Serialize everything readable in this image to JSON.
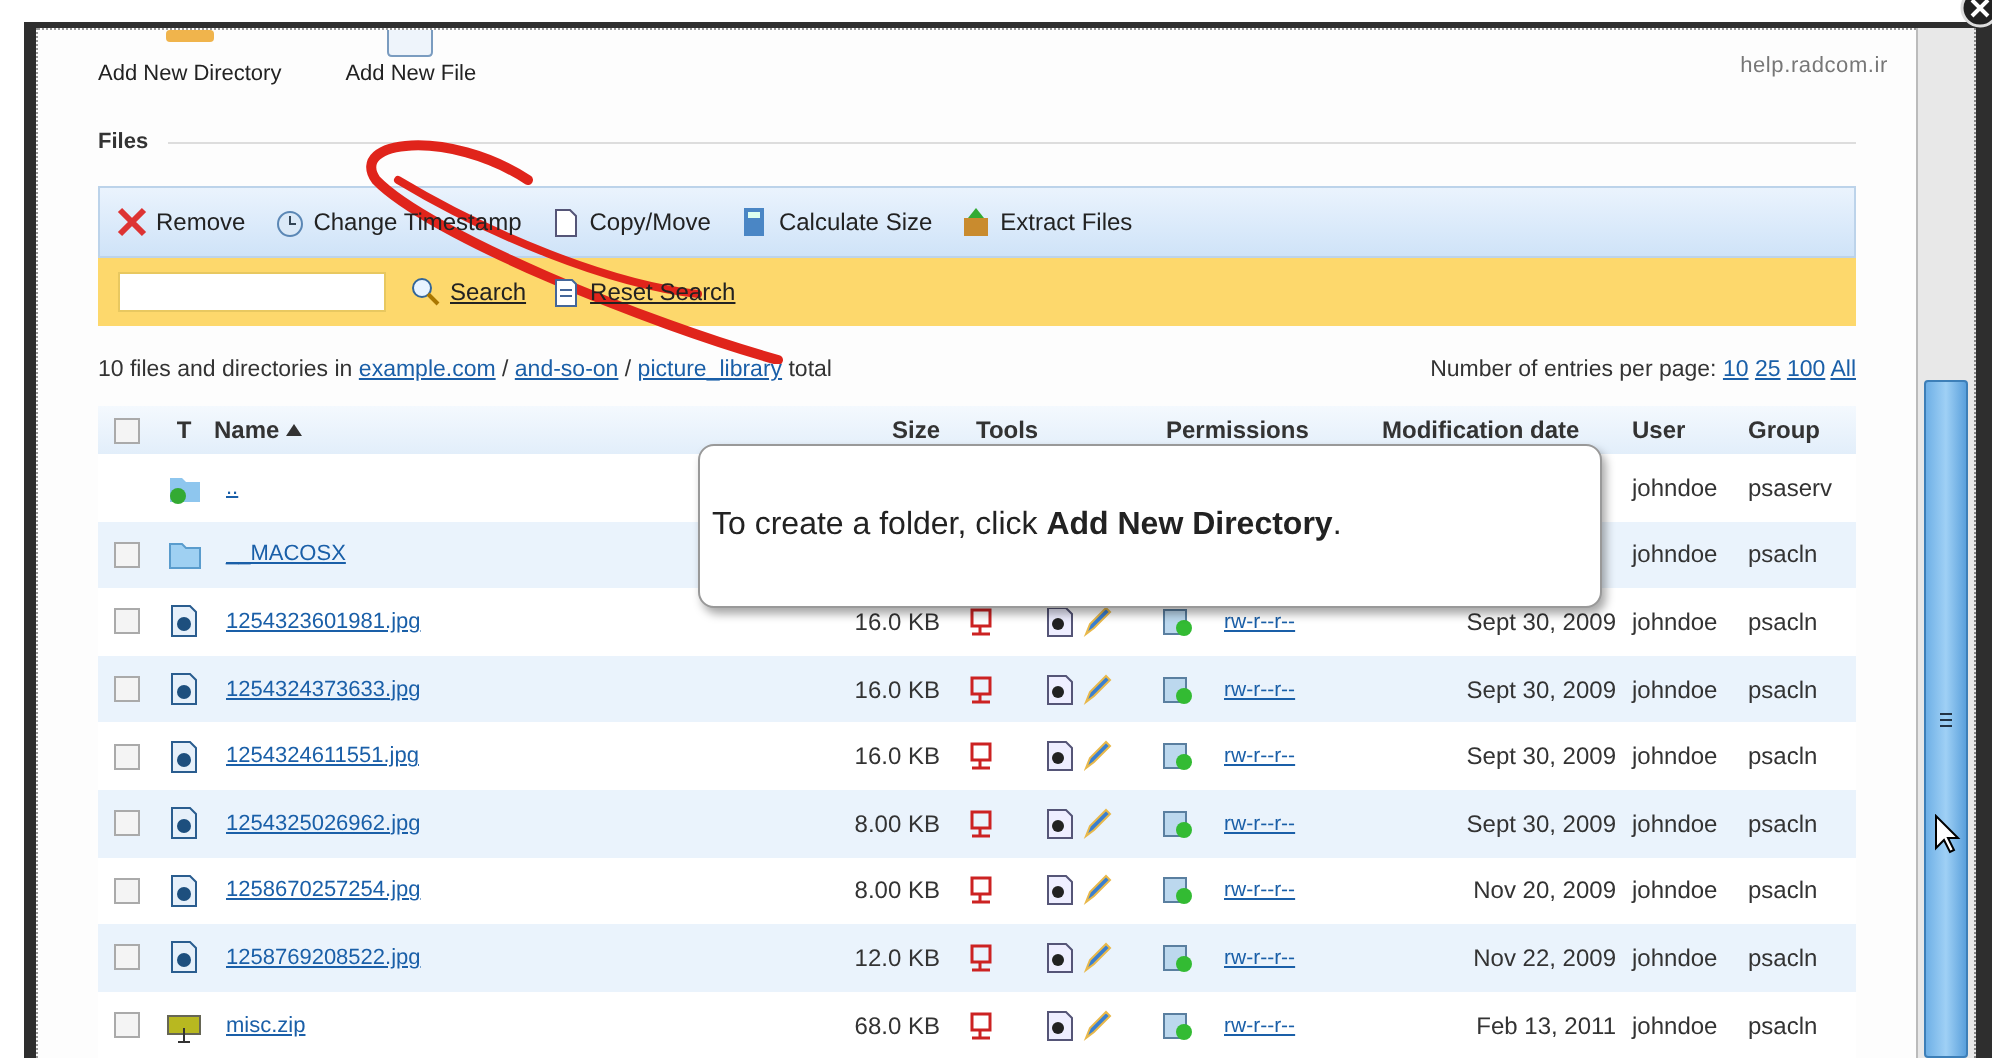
{
  "site_label": "help.radcom.ir",
  "actions": [
    {
      "kind": "directory",
      "label": "Add New Directory"
    },
    {
      "kind": "file",
      "label": "Add New File"
    }
  ],
  "section_title": "Files",
  "toolbar": [
    {
      "kind": "remove",
      "label": "Remove"
    },
    {
      "kind": "timestamp",
      "label": "Change Timestamp"
    },
    {
      "kind": "copy",
      "label": "Copy/Move"
    },
    {
      "kind": "size",
      "label": "Calculate Size"
    },
    {
      "kind": "extract",
      "label": "Extract Files"
    }
  ],
  "search": {
    "search_label": "Search",
    "reset_label": "Reset Search"
  },
  "summary": {
    "prefix": "10 files and directories in",
    "path": [
      "example.com",
      "and-so-on",
      "picture_library"
    ],
    "separator": "/",
    "suffix": "total"
  },
  "per_page": {
    "label": "Number of entries per page:",
    "options": [
      "10",
      "25",
      "100",
      "All"
    ]
  },
  "table": {
    "select_all_checked": false,
    "columns": [
      "T",
      "Name",
      "Size",
      "Tools",
      "Permissions",
      "Modification date",
      "User",
      "Group"
    ],
    "rows": [
      {
        "kind": "parent",
        "name": "..",
        "user": "johndoe",
        "group": "psaserv"
      },
      {
        "kind": "folder",
        "checked": false,
        "name": "__MACOSX",
        "user": "johndoe",
        "group": "psacln"
      },
      {
        "kind": "image",
        "checked": false,
        "name": "1254323601981.jpg",
        "size": "16.0 KB",
        "permissions": "rw-r--r--",
        "date": "Sept 30, 2009",
        "user": "johndoe",
        "group": "psacln"
      },
      {
        "kind": "image",
        "checked": false,
        "name": "1254324373633.jpg",
        "size": "16.0 KB",
        "permissions": "rw-r--r--",
        "date": "Sept 30, 2009",
        "user": "johndoe",
        "group": "psacln"
      },
      {
        "kind": "image",
        "checked": false,
        "name": "1254324611551.jpg",
        "size": "16.0 KB",
        "permissions": "rw-r--r--",
        "date": "Sept 30, 2009",
        "user": "johndoe",
        "group": "psacln"
      },
      {
        "kind": "image",
        "checked": false,
        "name": "1254325026962.jpg",
        "size": "8.00 KB",
        "permissions": "rw-r--r--",
        "date": "Sept 30, 2009",
        "user": "johndoe",
        "group": "psacln"
      },
      {
        "kind": "image",
        "checked": false,
        "name": "1258670257254.jpg",
        "size": "8.00 KB",
        "permissions": "rw-r--r--",
        "date": "Nov 20, 2009",
        "user": "johndoe",
        "group": "psacln"
      },
      {
        "kind": "image",
        "checked": false,
        "name": "1258769208522.jpg",
        "size": "12.0 KB",
        "permissions": "rw-r--r--",
        "date": "Nov 22, 2009",
        "user": "johndoe",
        "group": "psacln"
      },
      {
        "kind": "archive",
        "checked": false,
        "name": "misc.zip",
        "size": "68.0 KB",
        "permissions": "rw-r--r--",
        "date": "Feb 13, 2011",
        "user": "johndoe",
        "group": "psacln"
      }
    ]
  },
  "tooltip": "To create a folder, click **Add New Directory**."
}
